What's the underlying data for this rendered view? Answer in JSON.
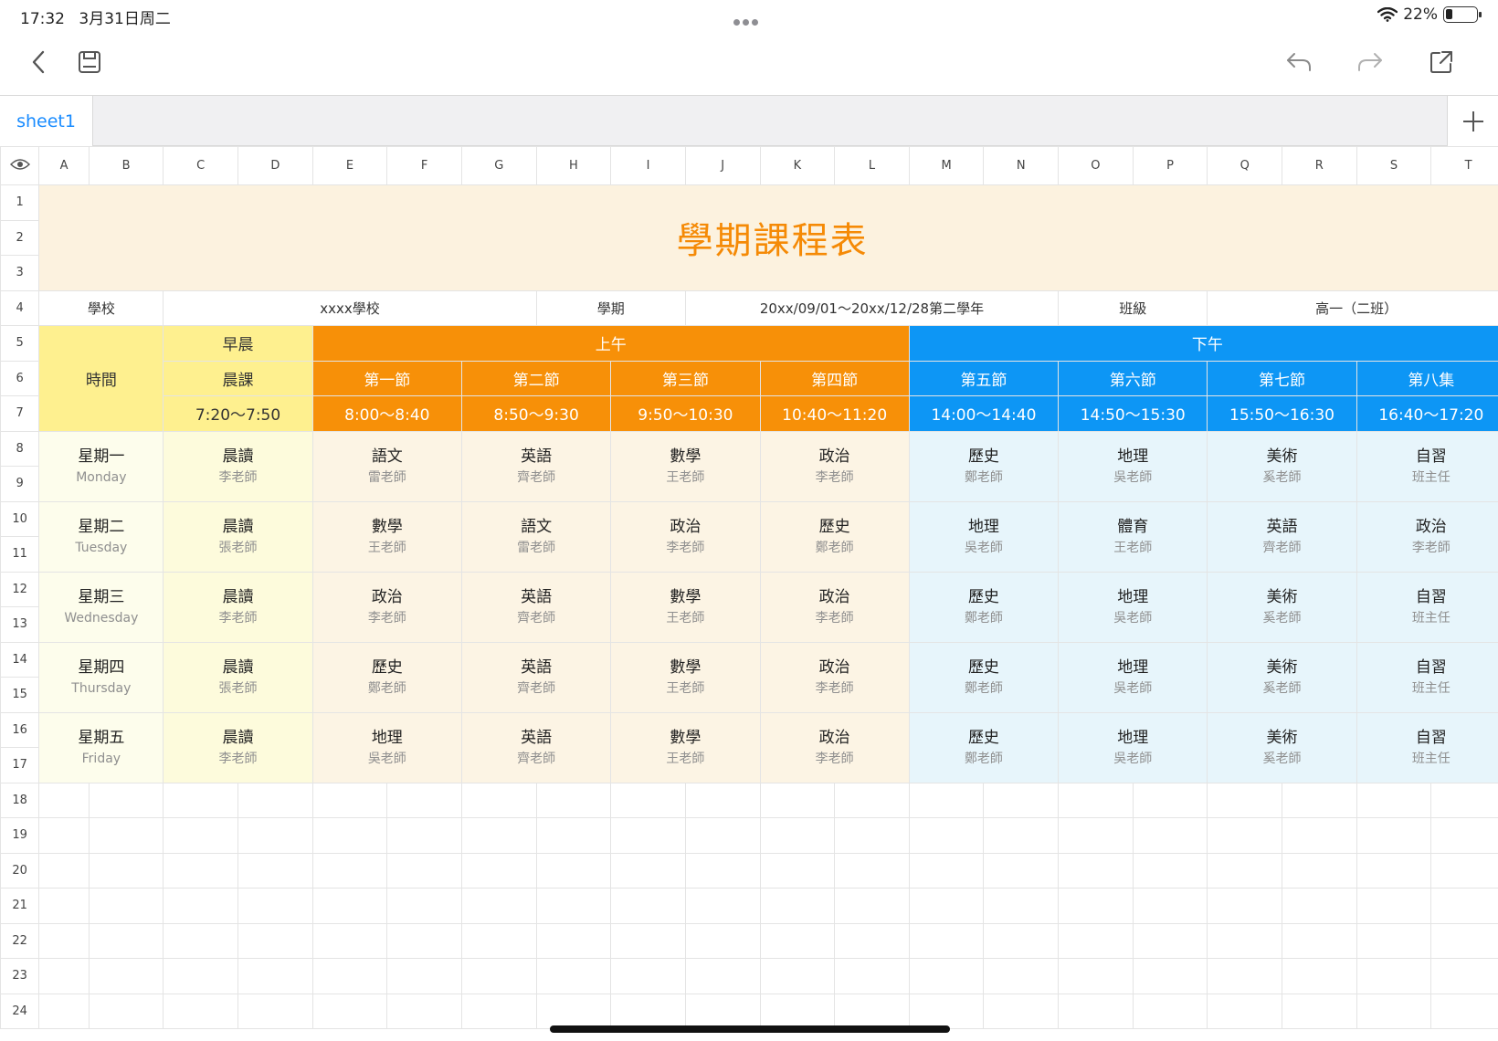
{
  "status": {
    "time": "17:32",
    "date": "3月31日周二",
    "battery": "22%",
    "battery_level": 0.22
  },
  "tabs": {
    "active": "sheet1"
  },
  "columns": [
    "A",
    "B",
    "C",
    "D",
    "E",
    "F",
    "G",
    "H",
    "I",
    "J",
    "K",
    "L",
    "M",
    "N",
    "O",
    "P",
    "Q",
    "R",
    "S",
    "T"
  ],
  "rows": [
    "1",
    "2",
    "3",
    "4",
    "5",
    "6",
    "7",
    "8",
    "9",
    "10",
    "11",
    "12",
    "13",
    "14",
    "15",
    "16",
    "17",
    "18",
    "19",
    "20",
    "21",
    "22",
    "23",
    "24"
  ],
  "sheet": {
    "title": "學期課程表",
    "info": {
      "school_label": "學校",
      "school_value": "xxxx學校",
      "term_label": "學期",
      "term_value": "20xx/09/01～20xx/12/28第二學年",
      "class_label": "班級",
      "class_value": "高一（二班）"
    },
    "header": {
      "time_label": "時間",
      "morning": "早晨",
      "am": "上午",
      "pm": "下午",
      "early_class": "晨課",
      "early_time": "7:20～7:50",
      "periods": [
        {
          "name": "第一節",
          "time": "8:00～8:40"
        },
        {
          "name": "第二節",
          "time": "8:50～9:30"
        },
        {
          "name": "第三節",
          "time": "9:50～10:30"
        },
        {
          "name": "第四節",
          "time": "10:40～11:20"
        },
        {
          "name": "第五節",
          "time": "14:00～14:40"
        },
        {
          "name": "第六節",
          "time": "14:50～15:30"
        },
        {
          "name": "第七節",
          "time": "15:50～16:30"
        },
        {
          "name": "第八集",
          "time": "16:40～17:20"
        }
      ]
    },
    "days": [
      {
        "zh": "星期一",
        "en": "Monday",
        "early": {
          "subject": "晨讀",
          "teacher": "李老師"
        },
        "classes": [
          {
            "subject": "語文",
            "teacher": "雷老師"
          },
          {
            "subject": "英語",
            "teacher": "齊老師"
          },
          {
            "subject": "數學",
            "teacher": "王老師"
          },
          {
            "subject": "政治",
            "teacher": "李老師"
          },
          {
            "subject": "歷史",
            "teacher": "鄭老師"
          },
          {
            "subject": "地理",
            "teacher": "吳老師"
          },
          {
            "subject": "美術",
            "teacher": "奚老師"
          },
          {
            "subject": "自習",
            "teacher": "班主任"
          }
        ]
      },
      {
        "zh": "星期二",
        "en": "Tuesday",
        "early": {
          "subject": "晨讀",
          "teacher": "張老師"
        },
        "classes": [
          {
            "subject": "數學",
            "teacher": "王老師"
          },
          {
            "subject": "語文",
            "teacher": "雷老師"
          },
          {
            "subject": "政治",
            "teacher": "李老師"
          },
          {
            "subject": "歷史",
            "teacher": "鄭老師"
          },
          {
            "subject": "地理",
            "teacher": "吳老師"
          },
          {
            "subject": "體育",
            "teacher": "王老師"
          },
          {
            "subject": "英語",
            "teacher": "齊老師"
          },
          {
            "subject": "政治",
            "teacher": "李老師"
          }
        ]
      },
      {
        "zh": "星期三",
        "en": "Wednesday",
        "early": {
          "subject": "晨讀",
          "teacher": "李老師"
        },
        "classes": [
          {
            "subject": "政治",
            "teacher": "李老師"
          },
          {
            "subject": "英語",
            "teacher": "齊老師"
          },
          {
            "subject": "數學",
            "teacher": "王老師"
          },
          {
            "subject": "政治",
            "teacher": "李老師"
          },
          {
            "subject": "歷史",
            "teacher": "鄭老師"
          },
          {
            "subject": "地理",
            "teacher": "吳老師"
          },
          {
            "subject": "美術",
            "teacher": "奚老師"
          },
          {
            "subject": "自習",
            "teacher": "班主任"
          }
        ]
      },
      {
        "zh": "星期四",
        "en": "Thursday",
        "early": {
          "subject": "晨讀",
          "teacher": "張老師"
        },
        "classes": [
          {
            "subject": "歷史",
            "teacher": "鄭老師"
          },
          {
            "subject": "英語",
            "teacher": "齊老師"
          },
          {
            "subject": "數學",
            "teacher": "王老師"
          },
          {
            "subject": "政治",
            "teacher": "李老師"
          },
          {
            "subject": "歷史",
            "teacher": "鄭老師"
          },
          {
            "subject": "地理",
            "teacher": "吳老師"
          },
          {
            "subject": "美術",
            "teacher": "奚老師"
          },
          {
            "subject": "自習",
            "teacher": "班主任"
          }
        ]
      },
      {
        "zh": "星期五",
        "en": "Friday",
        "early": {
          "subject": "晨讀",
          "teacher": "李老師"
        },
        "classes": [
          {
            "subject": "地理",
            "teacher": "吳老師"
          },
          {
            "subject": "英語",
            "teacher": "齊老師"
          },
          {
            "subject": "數學",
            "teacher": "王老師"
          },
          {
            "subject": "政治",
            "teacher": "李老師"
          },
          {
            "subject": "歷史",
            "teacher": "鄭老師"
          },
          {
            "subject": "地理",
            "teacher": "吳老師"
          },
          {
            "subject": "美術",
            "teacher": "奚老師"
          },
          {
            "subject": "自習",
            "teacher": "班主任"
          }
        ]
      }
    ]
  },
  "colors": {
    "accent": "#1a8cff",
    "title": "#f58a06",
    "am": "#f79008",
    "pm": "#0d96f5",
    "morning": "#fef08f"
  }
}
